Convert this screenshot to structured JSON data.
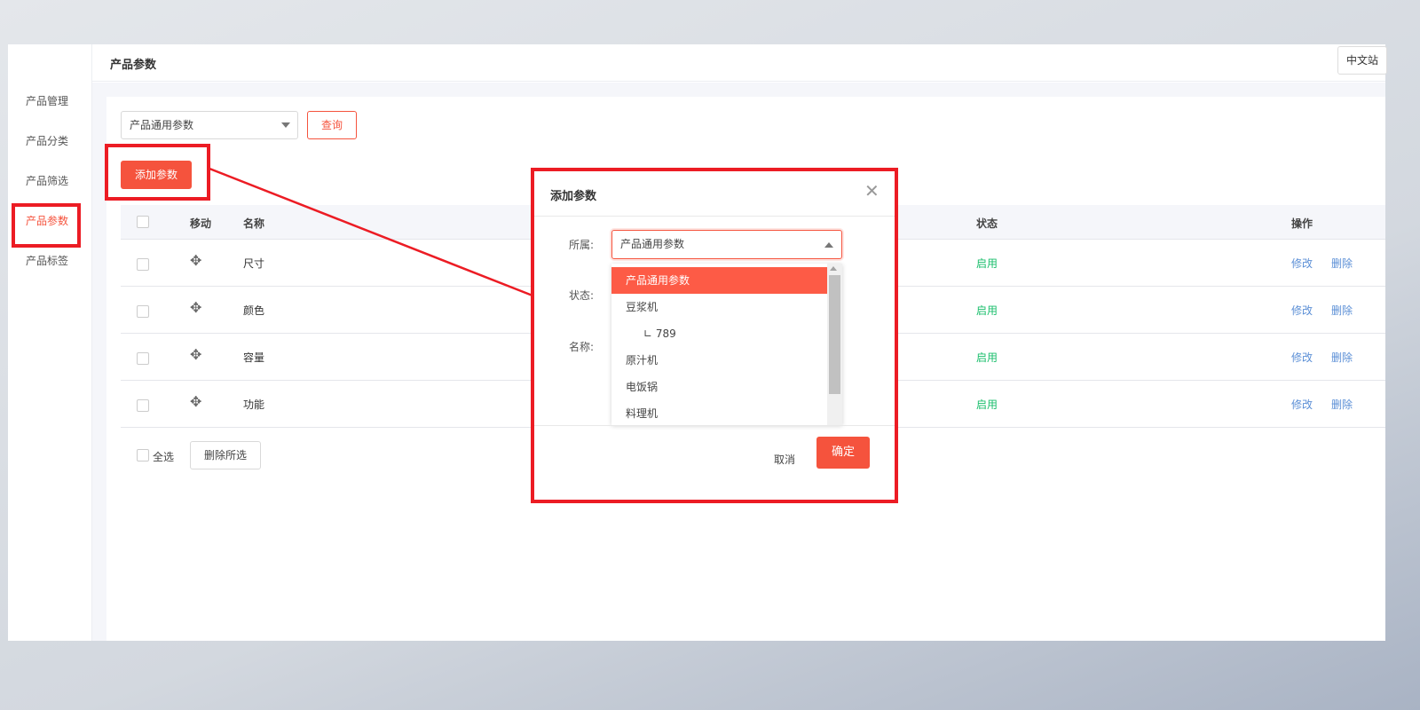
{
  "header": {
    "title": "产品参数",
    "lang_button": "中文站"
  },
  "sidebar": {
    "items": [
      {
        "label": "产品管理"
      },
      {
        "label": "产品分类"
      },
      {
        "label": "产品筛选"
      },
      {
        "label": "产品参数",
        "active": true
      },
      {
        "label": "产品标签"
      }
    ]
  },
  "filter": {
    "select_value": "产品通用参数",
    "query_label": "查询"
  },
  "toolbar": {
    "add_label": "添加参数"
  },
  "table": {
    "headers": {
      "move": "移动",
      "name": "名称",
      "status": "状态",
      "actions": "操作"
    },
    "rows": [
      {
        "name": "尺寸",
        "status": "启用",
        "edit": "修改",
        "delete": "删除"
      },
      {
        "name": "颜色",
        "status": "启用",
        "edit": "修改",
        "delete": "删除"
      },
      {
        "name": "容量",
        "status": "启用",
        "edit": "修改",
        "delete": "删除"
      },
      {
        "name": "功能",
        "status": "启用",
        "edit": "修改",
        "delete": "删除"
      }
    ],
    "select_all": "全选",
    "delete_selected": "删除所选"
  },
  "modal": {
    "title": "添加参数",
    "labels": {
      "belongs": "所属:",
      "status": "状态:",
      "name": "名称:"
    },
    "belongs_value": "产品通用参数",
    "options": [
      "产品通用参数",
      "豆浆机",
      "∟ 789",
      "原汁机",
      "电饭锅",
      "料理机"
    ],
    "cancel": "取消",
    "confirm": "确定"
  },
  "colors": {
    "accent": "#f5533d",
    "highlight": "#ec1c24",
    "status_green": "#19be6b",
    "link": "#5b8fd6"
  }
}
